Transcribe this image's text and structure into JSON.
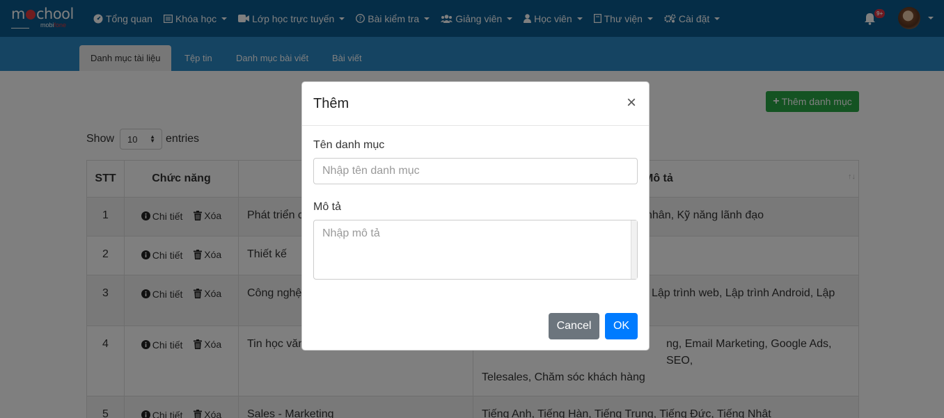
{
  "brand": {
    "logo_main_left": "m",
    "logo_main_right": "chool",
    "logo_sub_left": "mobi",
    "logo_sub_right": "fone"
  },
  "nav": {
    "items": [
      {
        "label": "Tổng quan",
        "icon": "dashboard-icon",
        "dropdown": false
      },
      {
        "label": "Khóa học",
        "icon": "book-icon",
        "dropdown": true
      },
      {
        "label": "Lớp học trực tuyến",
        "icon": "video-icon",
        "dropdown": true
      },
      {
        "label": "Bài kiểm tra",
        "icon": "question-circle-icon",
        "dropdown": true
      },
      {
        "label": "Giảng viên",
        "icon": "users-icon",
        "dropdown": true
      },
      {
        "label": "Học viên",
        "icon": "user-icon",
        "dropdown": true
      },
      {
        "label": "Thư viện",
        "icon": "library-icon",
        "dropdown": true
      },
      {
        "label": "Cài đặt",
        "icon": "cogs-icon",
        "dropdown": true
      }
    ],
    "notification_badge": "9+"
  },
  "tabs": [
    {
      "label": "Danh mục tài liệu",
      "active": true
    },
    {
      "label": "Tệp tin",
      "active": false
    },
    {
      "label": "Danh mục bài viết",
      "active": false
    },
    {
      "label": "Bài viết",
      "active": false
    }
  ],
  "toolbar": {
    "add_label": "Thêm danh mục"
  },
  "length": {
    "show": "Show",
    "value": "10",
    "entries": "entries"
  },
  "table": {
    "headers": {
      "stt": "STT",
      "actions": "Chức năng",
      "name": "",
      "desc": "Mô tả"
    },
    "action_detail": "Chi tiết",
    "action_delete": "Xóa",
    "rows": [
      {
        "stt": "1",
        "name": "Phát triển c",
        "desc": "nhân, Kỹ năng lãnh đạo"
      },
      {
        "stt": "2",
        "name": "Thiết kế",
        "desc": ""
      },
      {
        "stt": "3",
        "name": "Công nghệ",
        "desc": "Lập trình web, Lập trình Android, Lập"
      },
      {
        "stt": "4",
        "name": "Tin học văn",
        "desc": "ng, Email Marketing, Google Ads, SEO,",
        "desc2": "Telesales, Chăm sóc khách hàng"
      },
      {
        "stt": "5",
        "name": "Sales - Marketing",
        "desc": "Tiếng Anh, Tiếng Hàn, Tiếng Trung, Tiếng Đức, Tiếng Nhật"
      }
    ]
  },
  "modal": {
    "title": "Thêm",
    "close": "×",
    "name_label": "Tên danh mục",
    "name_placeholder": "Nhập tên danh mục",
    "desc_label": "Mô tả",
    "desc_placeholder": "Nhập mô tả",
    "cancel": "Cancel",
    "ok": "OK"
  },
  "colors": {
    "navbar": "#0a5a8f",
    "subbar": "#2b88c4",
    "add": "#28a745",
    "ok": "#007bff",
    "cancel": "#6c757d",
    "badge": "#dc3545"
  }
}
